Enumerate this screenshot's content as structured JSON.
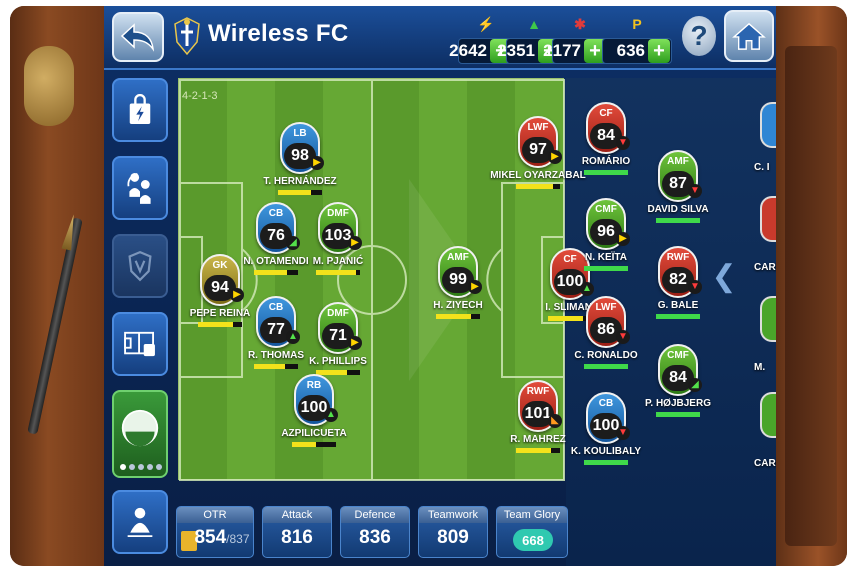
{
  "header": {
    "team_name": "Wireless FC",
    "resources": [
      {
        "icon": "energy-icon",
        "glyph": "⚡",
        "color": "#f5b21c",
        "value": "2642"
      },
      {
        "icon": "tree-icon",
        "glyph": "▲",
        "color": "#3ec84a",
        "value": "2351"
      },
      {
        "icon": "star-coin-icon",
        "glyph": "✱",
        "color": "#e23b3b",
        "value": "2177"
      },
      {
        "icon": "gp-coin-icon",
        "glyph": "P",
        "color": "#f2c21e",
        "value": "636"
      }
    ],
    "plus_label": "+",
    "help_label": "?"
  },
  "formation": "4-2-1-3",
  "starting_xi": [
    {
      "pos": "LB",
      "rating": "98",
      "name": "T. HERNÁNDEZ",
      "type": "def",
      "cond": "▶",
      "cond_color": "yellow",
      "bar_fill": 0.75
    },
    {
      "pos": "CB",
      "rating": "76",
      "name": "N. OTAMENDI",
      "type": "def",
      "cond": "◢",
      "cond_color": "green",
      "bar_fill": 0.75
    },
    {
      "pos": "DMF",
      "rating": "103",
      "name": "M. PJANIĆ",
      "type": "mid",
      "cond": "▶",
      "cond_color": "yellow",
      "bar_fill": 0.9
    },
    {
      "pos": "GK",
      "rating": "94",
      "name": "PEPE REINA",
      "type": "gk",
      "cond": "▶",
      "cond_color": "yellow",
      "bar_fill": 0.8
    },
    {
      "pos": "CB",
      "rating": "77",
      "name": "R. THOMAS",
      "type": "def",
      "cond": "▲",
      "cond_color": "green",
      "bar_fill": 0.7
    },
    {
      "pos": "DMF",
      "rating": "71",
      "name": "K. PHILLIPS",
      "type": "mid",
      "cond": "▶",
      "cond_color": "yellow",
      "bar_fill": 0.7
    },
    {
      "pos": "RB",
      "rating": "100",
      "name": "AZPILICUETA",
      "type": "def",
      "cond": "▲",
      "cond_color": "green",
      "bar_fill": 0.55
    },
    {
      "pos": "AMF",
      "rating": "99",
      "name": "H. ZIYECH",
      "type": "mid",
      "cond": "▶",
      "cond_color": "yellow",
      "bar_fill": 0.8
    },
    {
      "pos": "LWF",
      "rating": "97",
      "name": "MIKEL OYARZABAL",
      "type": "att",
      "cond": "▶",
      "cond_color": "yellow",
      "bar_fill": 0.85
    },
    {
      "pos": "CF",
      "rating": "100",
      "name": "I. SLIMANI",
      "type": "att",
      "cond": "▲",
      "cond_color": "green",
      "bar_fill": 0.8
    },
    {
      "pos": "RWF",
      "rating": "101",
      "name": "R. MAHREZ",
      "type": "att",
      "cond": "◣",
      "cond_color": "orange",
      "bar_fill": 0.8
    }
  ],
  "substitutes": [
    {
      "pos": "CF",
      "rating": "84",
      "name": "ROMÁRIO",
      "type": "att",
      "cond": "▼",
      "cond_color": "red"
    },
    {
      "pos": "CMF",
      "rating": "96",
      "name": "N. KEÏTA",
      "type": "mid",
      "cond": "▶",
      "cond_color": "yellow"
    },
    {
      "pos": "LWF",
      "rating": "86",
      "name": "C. RONALDO",
      "type": "att",
      "cond": "▼",
      "cond_color": "red"
    },
    {
      "pos": "CB",
      "rating": "100",
      "name": "K. KOULIBALY",
      "type": "def",
      "cond": "▼",
      "cond_color": "red"
    },
    {
      "pos": "AMF",
      "rating": "87",
      "name": "DAVID SILVA",
      "type": "mid",
      "cond": "▼",
      "cond_color": "red"
    },
    {
      "pos": "RWF",
      "rating": "82",
      "name": "G. BALE",
      "type": "att",
      "cond": "▼",
      "cond_color": "red"
    },
    {
      "pos": "CMF",
      "rating": "84",
      "name": "P. HØJBJERG",
      "type": "mid",
      "cond": "◢",
      "cond_color": "green"
    }
  ],
  "reserves_edge": [
    {
      "name": "C. I",
      "type": "def"
    },
    {
      "name": "CARI",
      "type": "att"
    },
    {
      "name": "M.",
      "type": "mid"
    },
    {
      "name": "CARL",
      "type": "mid"
    }
  ],
  "stats": [
    {
      "label": "OTR",
      "value": "854",
      "sub": "/837"
    },
    {
      "label": "Attack",
      "value": "816"
    },
    {
      "label": "Defence",
      "value": "836"
    },
    {
      "label": "Teamwork",
      "value": "809"
    },
    {
      "label": "Team Glory",
      "value": "668"
    }
  ],
  "sidebar": {
    "items": [
      {
        "name": "shop-menu",
        "icon": "shopping-bag-icon"
      },
      {
        "name": "transfer-menu",
        "icon": "player-swap-icon"
      },
      {
        "name": "club-menu",
        "icon": "shield-icon"
      },
      {
        "name": "formation-menu",
        "icon": "formation-board-icon"
      },
      {
        "name": "team-menu",
        "icon": "team-icon"
      },
      {
        "name": "match-menu",
        "icon": "coach-icon"
      }
    ],
    "team_page_dots": 5
  }
}
